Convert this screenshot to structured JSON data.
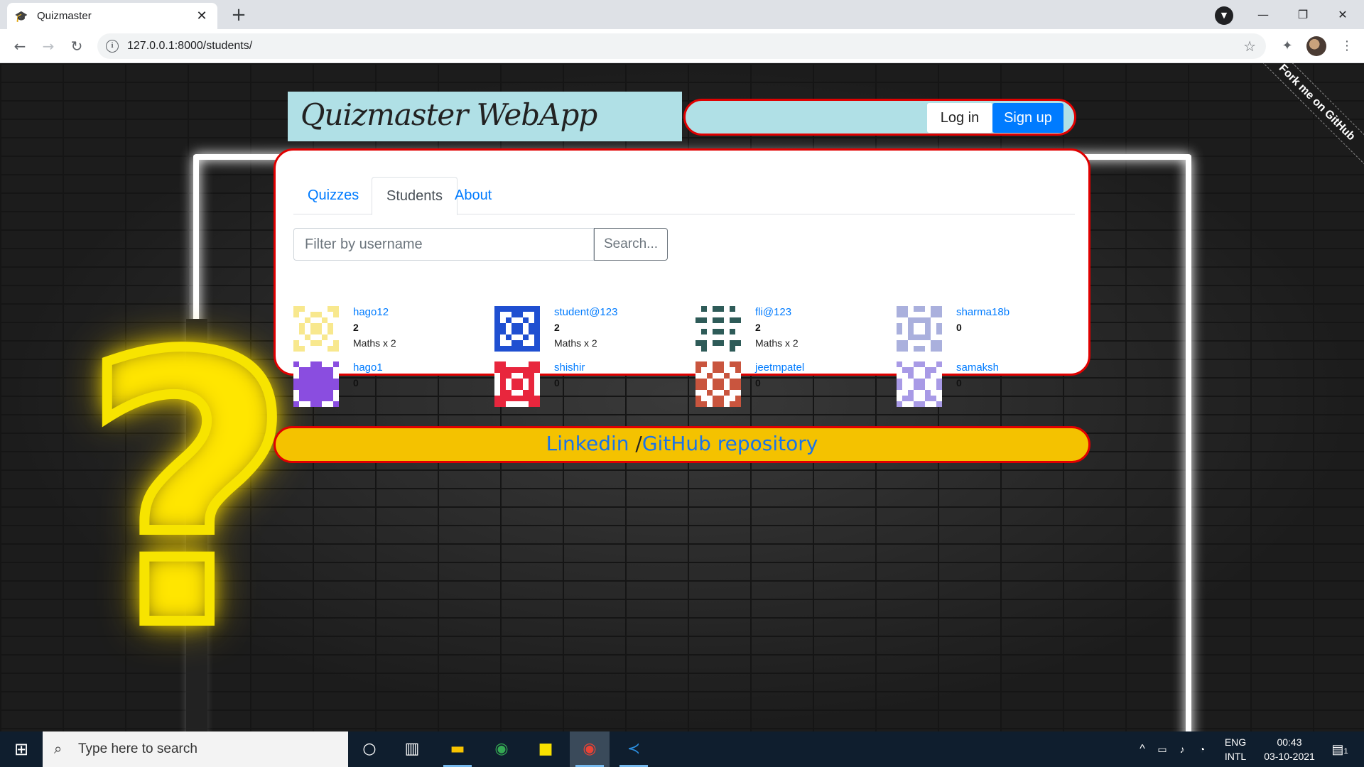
{
  "browser": {
    "tab_title": "Quizmaster",
    "new_tab_symbol": "+",
    "close_symbol": "✕",
    "url": "127.0.0.1:8000/students/",
    "window_controls": {
      "minimize": "—",
      "maximize": "❐",
      "close": "✕"
    }
  },
  "site": {
    "brand": "Quizmaster WebApp",
    "login_label": "Log in",
    "signup_label": "Sign up",
    "fork_ribbon": "Fork me on GitHub"
  },
  "tabs": [
    {
      "label": "Quizzes",
      "active": false
    },
    {
      "label": "Students",
      "active": true
    },
    {
      "label": "About",
      "active": false
    }
  ],
  "filter": {
    "placeholder": "Filter by username",
    "search_label": "Search..."
  },
  "students": [
    {
      "username": "hago12",
      "score": "2",
      "subjects": "Maths x 2",
      "avatar_color": "#f8e88e"
    },
    {
      "username": "student@123",
      "score": "2",
      "subjects": "Maths x 2",
      "avatar_color": "#1f4fd1"
    },
    {
      "username": "fli@123",
      "score": "2",
      "subjects": "Maths x 2",
      "avatar_color": "#2e5b58"
    },
    {
      "username": "sharma18b",
      "score": "0",
      "subjects": "",
      "avatar_color": "#aab0dd"
    },
    {
      "username": "hago1",
      "score": "0",
      "subjects": "",
      "avatar_color": "#8a4de0"
    },
    {
      "username": "shishir",
      "score": "0",
      "subjects": "",
      "avatar_color": "#e8263d"
    },
    {
      "username": "jeetmpatel",
      "score": "0",
      "subjects": "",
      "avatar_color": "#c9553e"
    },
    {
      "username": "samaksh",
      "score": "0",
      "subjects": "",
      "avatar_color": "#a89ae6"
    }
  ],
  "footer": {
    "linkedin": "Linkedin",
    "separator": " /",
    "github": "GitHub repository"
  },
  "taskbar": {
    "search_placeholder": "Type here to search",
    "language_top": "ENG",
    "language_bottom": "INTL",
    "time": "00:43",
    "date": "03-10-2021",
    "notification_count": "1"
  }
}
